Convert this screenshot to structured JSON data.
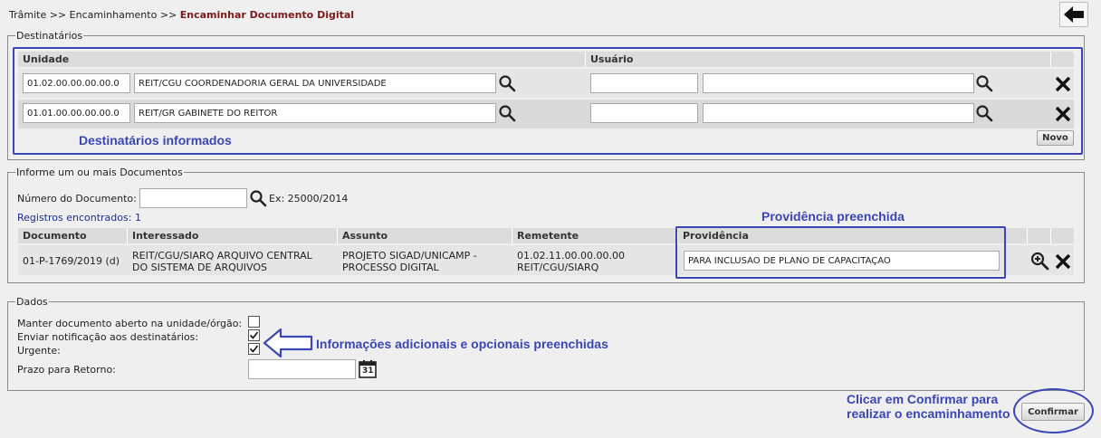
{
  "breadcrumb": {
    "part1": "Trâmite",
    "sep1": ">>",
    "part2": "Encaminhamento",
    "sep2": ">>",
    "current": "Encaminhar Documento Digital"
  },
  "destinatarios": {
    "legend": "Destinatários",
    "col_unidade": "Unidade",
    "col_usuario": "Usuário",
    "rows": [
      {
        "codigo": "01.02.00.00.00.00.0",
        "nome": "REIT/CGU COORDENADORIA GERAL DA UNIVERSIDADE",
        "usuario_id": "",
        "usuario_nome": ""
      },
      {
        "codigo": "01.01.00.00.00.00.0",
        "nome": "REIT/GR GABINETE DO REITOR",
        "usuario_id": "",
        "usuario_nome": ""
      }
    ],
    "novo_label": "Novo",
    "annotation": "Destinatários informados"
  },
  "documentos": {
    "legend": "Informe um ou mais Documentos",
    "numero_label": "Número do Documento:",
    "numero_value": "",
    "exemplo": "Ex: 25000/2014",
    "registros": "Registros encontrados: 1",
    "columns": {
      "documento": "Documento",
      "interessado": "Interessado",
      "assunto": "Assunto",
      "remetente": "Remetente",
      "providencia": "Providência"
    },
    "row": {
      "documento": "01-P-1769/2019 (d)",
      "interessado_l1": "REIT/CGU/SIARQ ARQUIVO CENTRAL",
      "interessado_l2": "DO SISTEMA DE ARQUIVOS",
      "assunto_l1": "PROJETO SIGAD/UNICAMP -",
      "assunto_l2": "PROCESSO DIGITAL",
      "remetente_l1": "01.02.11.00.00.00.00",
      "remetente_l2": "REIT/CGU/SIARQ",
      "providencia": "PARA INCLUSÃO DE PLANO DE CAPACITAÇÃO"
    },
    "annotation": "Providência preenchida"
  },
  "dados": {
    "legend": "Dados",
    "manter_label": "Manter documento aberto na unidade/órgão:",
    "manter_checked": false,
    "notificacao_label": "Enviar notificação aos destinatários:",
    "notificacao_checked": true,
    "urgente_label": "Urgente:",
    "urgente_checked": true,
    "prazo_label": "Prazo para Retorno:",
    "prazo_value": "",
    "calendar_day": "31",
    "annotation": "Informações adicionais e opcionais preenchidas"
  },
  "footer": {
    "confirm_note_l1": "Clicar em Confirmar para",
    "confirm_note_l2": "realizar o encaminhamento",
    "confirmar_label": "Confirmar"
  },
  "colors": {
    "annotation_blue": "#3a46b5",
    "header_gray": "#dcdcdc",
    "crumb_current": "#7a1a1a"
  },
  "icons": [
    "back-arrow-icon",
    "search-icon",
    "delete-x-icon",
    "zoom-in-icon",
    "calendar-icon",
    "arrow-left-outline-icon"
  ]
}
